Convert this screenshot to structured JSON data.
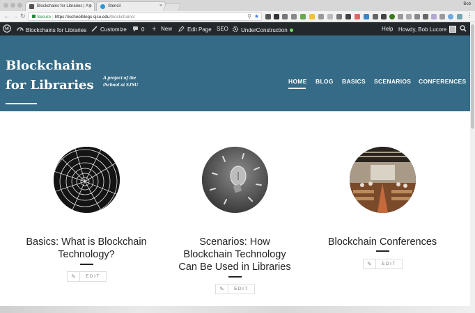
{
  "browser": {
    "tabs": [
      {
        "title": "Blockchains for Libraries | A p",
        "active": true
      },
      {
        "title": "Stencil",
        "active": false
      }
    ],
    "profile_name": "Bob",
    "url": {
      "secure_label": "Secure",
      "host": "https://ischoolblogs.sjsu.edu",
      "path": "/blockchains/"
    },
    "close_glyph": "×"
  },
  "admin_bar": {
    "site_name": "Blockchains for Libraries",
    "customize": "Customize",
    "comments_count": "0",
    "new": "New",
    "edit_page": "Edit Page",
    "seo": "SEO",
    "under_construction": "UnderConstruction",
    "help": "Help",
    "howdy": "Howdy, Bob Lucore"
  },
  "site": {
    "title_line1": "Blockchains",
    "title_line2": "for Libraries",
    "tagline_line1": "A project of the",
    "tagline_line2": "iSchool at SJSU",
    "nav": [
      "HOME",
      "BLOG",
      "BASICS",
      "SCENARIOS",
      "CONFERENCES"
    ],
    "active_nav": "HOME"
  },
  "cards": [
    {
      "title_lines": [
        "Basics: What is Blockchain",
        "Technology?"
      ],
      "image": "spiderweb",
      "edit_label": "EDIT"
    },
    {
      "title_lines": [
        "Scenarios: How",
        "Blockchain Technology",
        "Can Be Used in Libraries"
      ],
      "image": "lightbulb",
      "edit_label": "EDIT"
    },
    {
      "title_lines": [
        "Blockchain Conferences"
      ],
      "image": "conference-room",
      "edit_label": "EDIT"
    }
  ],
  "colors": {
    "header_bg": "#356b86",
    "admin_bar_bg": "#23282d",
    "secure_green": "#1b8e3a"
  }
}
